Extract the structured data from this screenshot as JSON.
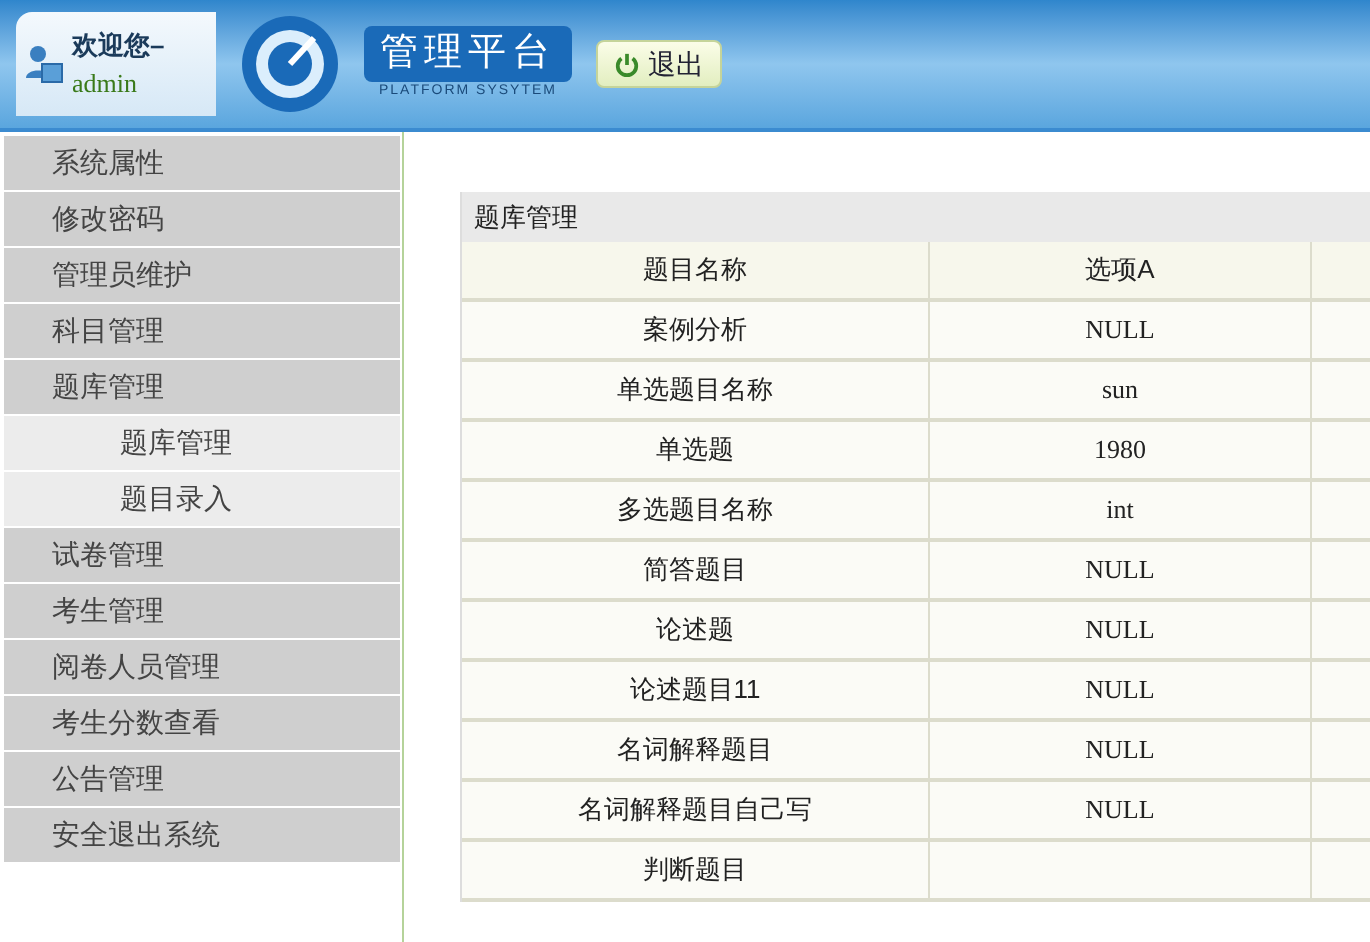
{
  "header": {
    "welcome": "欢迎您–",
    "user": "admin",
    "title": "管理平台",
    "subtitle": "PLATFORM SYSYTEM",
    "logout": "退出"
  },
  "sidebar": {
    "items": [
      {
        "label": "系统属性"
      },
      {
        "label": "修改密码"
      },
      {
        "label": "管理员维护"
      },
      {
        "label": "科目管理"
      },
      {
        "label": "题库管理",
        "children": [
          {
            "label": "题库管理"
          },
          {
            "label": "题目录入"
          }
        ]
      },
      {
        "label": "试卷管理"
      },
      {
        "label": "考生管理"
      },
      {
        "label": "阅卷人员管理"
      },
      {
        "label": "考生分数查看"
      },
      {
        "label": "公告管理"
      },
      {
        "label": "安全退出系统"
      }
    ]
  },
  "panel": {
    "title": "题库管理",
    "table": {
      "columns": [
        "题目名称",
        "选项A"
      ],
      "rows": [
        {
          "name": "案例分析",
          "option_a": "NULL"
        },
        {
          "name": "单选题目名称",
          "option_a": "sun"
        },
        {
          "name": "单选题",
          "option_a": "1980"
        },
        {
          "name": "多选题目名称",
          "option_a": "int"
        },
        {
          "name": "简答题目",
          "option_a": "NULL"
        },
        {
          "name": "论述题",
          "option_a": "NULL"
        },
        {
          "name": "论述题目11",
          "option_a": "NULL"
        },
        {
          "name": "名词解释题目",
          "option_a": "NULL"
        },
        {
          "name": "名词解释题目自己写",
          "option_a": "NULL"
        },
        {
          "name": "判断题目"
        }
      ]
    }
  }
}
